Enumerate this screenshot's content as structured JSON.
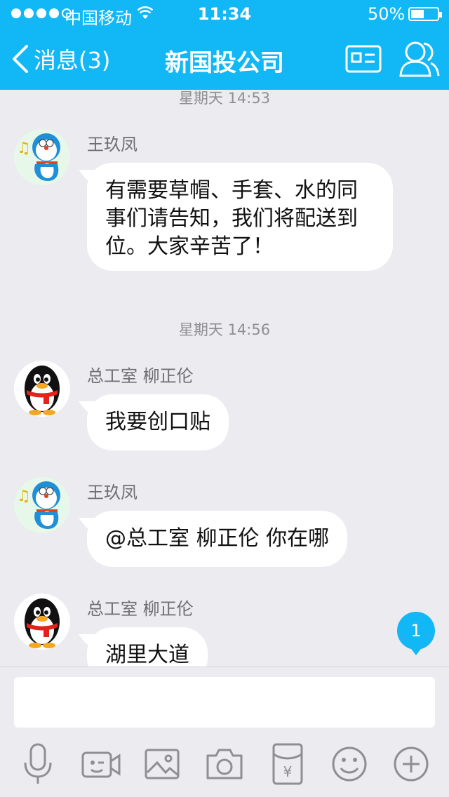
{
  "status": {
    "carrier": "中国移动",
    "time": "11:34",
    "battery": "50%"
  },
  "nav": {
    "back_label": "消息(3)",
    "title": "新国投公司"
  },
  "messages": [
    {
      "timestamp": "星期天 14:53",
      "sender": "王玖凤",
      "text": "有需要草帽、手套、水的同事们请告知，我们将配送到位。大家辛苦了！",
      "avatar": "doraemon-avatar"
    },
    {
      "timestamp": "星期天 14:56",
      "sender": "总工室 柳正伦",
      "text": "我要创口贴",
      "avatar": "qq-penguin-avatar"
    },
    {
      "sender": "王玖凤",
      "text": "@总工室 柳正伦 你在哪",
      "avatar": "doraemon-avatar"
    },
    {
      "sender": "总工室 柳正伦",
      "text": "湖里大道",
      "avatar": "qq-penguin-avatar"
    }
  ],
  "unread_badge": "1",
  "input": {
    "placeholder": ""
  },
  "toolbar": [
    "mic-icon",
    "video-icon",
    "image-icon",
    "camera-icon",
    "red-packet-icon",
    "emoji-icon",
    "plus-icon"
  ],
  "colors": {
    "accent": "#12b7f5",
    "background": "#ebebf0",
    "bubble": "#ffffff"
  }
}
